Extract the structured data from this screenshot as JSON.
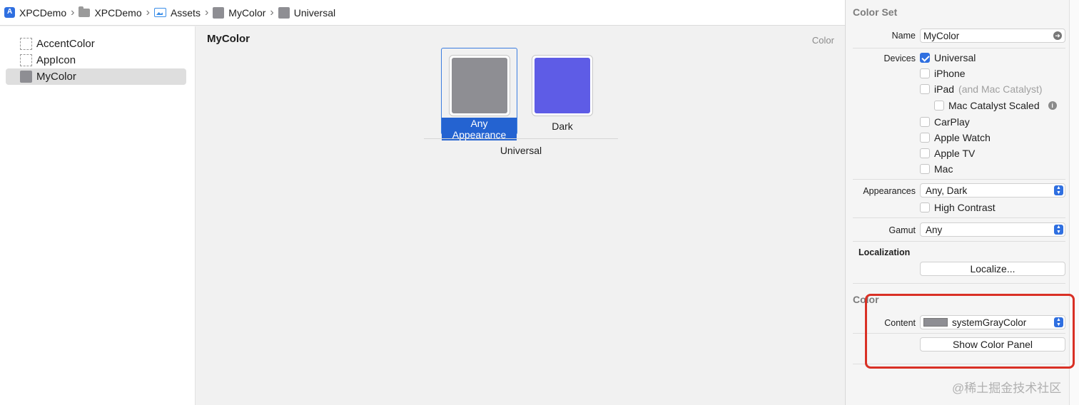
{
  "breadcrumb": {
    "items": [
      {
        "label": "XPCDemo",
        "icon": "app-icon"
      },
      {
        "label": "XPCDemo",
        "icon": "folder-icon"
      },
      {
        "label": "Assets",
        "icon": "assets-icon"
      },
      {
        "label": "MyColor",
        "icon": "color-swatch-icon"
      },
      {
        "label": "Universal",
        "icon": "color-swatch-icon"
      }
    ]
  },
  "sidebar": {
    "items": [
      {
        "label": "AccentColor",
        "icon": "dashed-placeholder-icon"
      },
      {
        "label": "AppIcon",
        "icon": "dashed-placeholder-icon"
      },
      {
        "label": "MyColor",
        "icon": "color-swatch-icon",
        "selected": true
      }
    ]
  },
  "main": {
    "title": "MyColor",
    "kind": "Color",
    "wells": [
      {
        "label": "Any Appearance",
        "color": "#8e8e93",
        "selected": true
      },
      {
        "label": "Dark",
        "color": "#5e5ce6"
      }
    ],
    "group_label": "Universal"
  },
  "inspector": {
    "color_set": {
      "title": "Color Set",
      "name_label": "Name",
      "name_value": "MyColor",
      "devices_label": "Devices",
      "devices": [
        {
          "label": "Universal",
          "checked": true
        },
        {
          "label": "iPhone",
          "checked": false
        },
        {
          "label": "iPad",
          "note": "(and Mac Catalyst)",
          "checked": false
        },
        {
          "label": "Mac Catalyst Scaled",
          "checked": false
        },
        {
          "label": "CarPlay",
          "checked": false
        },
        {
          "label": "Apple Watch",
          "checked": false
        },
        {
          "label": "Apple TV",
          "checked": false
        },
        {
          "label": "Mac",
          "checked": false
        }
      ],
      "appearances_label": "Appearances",
      "appearances_value": "Any, Dark",
      "high_contrast_label": "High Contrast",
      "gamut_label": "Gamut",
      "gamut_value": "Any"
    },
    "localization": {
      "title": "Localization",
      "button": "Localize..."
    },
    "color": {
      "title": "Color",
      "content_label": "Content",
      "content_value": "systemGrayColor",
      "content_swatch": "#8e8e93",
      "show_panel_button": "Show Color Panel"
    }
  },
  "colors": {
    "accent": "#2f6fe0",
    "highlight": "#d93025",
    "gray": "#8e8e93",
    "dark": "#5e5ce6"
  },
  "watermark": "@稀土掘金技术社区"
}
